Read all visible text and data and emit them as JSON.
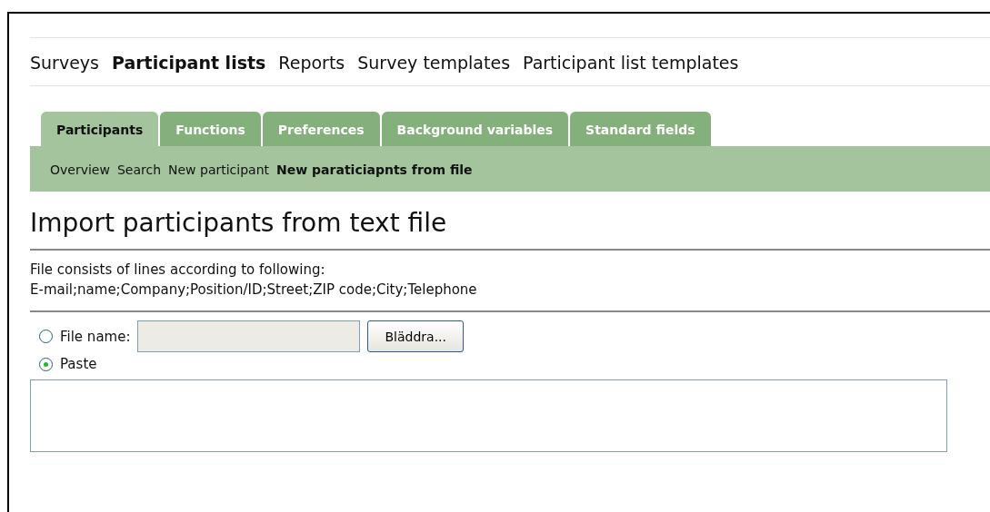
{
  "nav": [
    {
      "label": "Surveys",
      "selected": false
    },
    {
      "label": "Participant lists",
      "selected": true
    },
    {
      "label": "Reports",
      "selected": false
    },
    {
      "label": "Survey templates",
      "selected": false
    },
    {
      "label": "Participant list templates",
      "selected": false
    }
  ],
  "tabs": [
    {
      "label": "Participants",
      "selected": true
    },
    {
      "label": "Functions",
      "selected": false
    },
    {
      "label": "Preferences",
      "selected": false
    },
    {
      "label": "Background variables",
      "selected": false
    },
    {
      "label": "Standard fields",
      "selected": false
    }
  ],
  "subnav": [
    {
      "label": "Overview",
      "selected": false
    },
    {
      "label": "Search",
      "selected": false
    },
    {
      "label": "New participant",
      "selected": false
    },
    {
      "label": "New paraticiapnts from file",
      "selected": true
    }
  ],
  "heading": "Import participants from text file",
  "description": [
    "File consists of lines according to following:",
    "E-mail;name;Company;Position/ID;Street;ZIP code;City;Telephone"
  ],
  "options": [
    {
      "kind": "file",
      "label": "File name:",
      "selected": false,
      "button": "Bläddra..."
    },
    {
      "kind": "paste",
      "label": "Paste",
      "selected": true
    }
  ]
}
